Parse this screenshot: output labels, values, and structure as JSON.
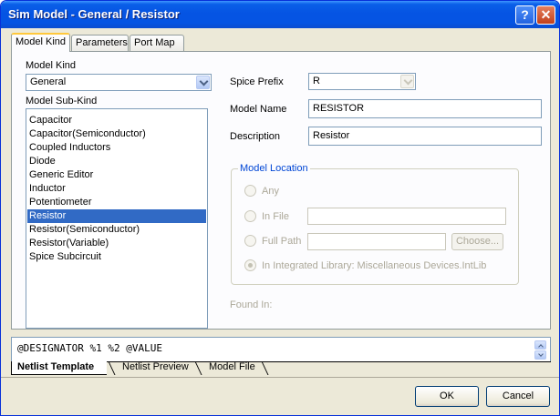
{
  "window": {
    "title": "Sim Model - General / Resistor",
    "help_label": "?",
    "close_label": "✕"
  },
  "tabs": [
    {
      "label": "Model Kind",
      "active": true
    },
    {
      "label": "Parameters",
      "active": false
    },
    {
      "label": "Port Map",
      "active": false
    }
  ],
  "model_kind": {
    "label": "Model Kind",
    "selected": "General",
    "subkind_label": "Model Sub-Kind",
    "subkinds": [
      "Capacitor",
      "Capacitor(Semiconductor)",
      "Coupled Inductors",
      "Diode",
      "Generic Editor",
      "Inductor",
      "Potentiometer",
      "Resistor",
      "Resistor(Semiconductor)",
      "Resistor(Variable)",
      "Spice Subcircuit"
    ],
    "selected_subkind": "Resistor"
  },
  "spice_prefix": {
    "label": "Spice Prefix",
    "value": "R"
  },
  "model_name": {
    "label": "Model Name",
    "value": "RESISTOR"
  },
  "description": {
    "label": "Description",
    "value": "Resistor"
  },
  "model_location": {
    "title": "Model Location",
    "options": {
      "any": "Any",
      "in_file": "In File",
      "full_path": "Full Path",
      "integrated": "In Integrated Library: Miscellaneous Devices.IntLib"
    },
    "selected": "integrated",
    "choose_label": "Choose...",
    "in_file_value": "",
    "full_path_value": ""
  },
  "found_in": {
    "label": "Found In:"
  },
  "netlist": {
    "template": "@DESIGNATOR %1 %2 @VALUE",
    "tabs": [
      "Netlist Template",
      "Netlist Preview",
      "Model File"
    ],
    "active_tab": "Netlist Template"
  },
  "buttons": {
    "ok": "OK",
    "cancel": "Cancel"
  },
  "colors": {
    "title_bar": "#0554e3",
    "selection": "#316ac5",
    "group_title": "#0046d5",
    "tab_highlight": "#ffc83c"
  }
}
